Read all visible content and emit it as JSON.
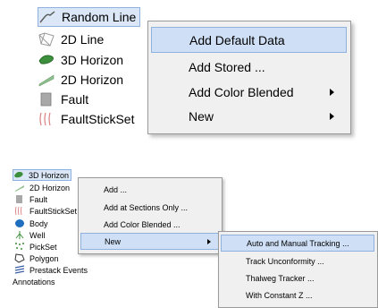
{
  "top": {
    "tree": [
      {
        "label": "Random Line",
        "icon": "random-line-icon"
      },
      {
        "label": "2D Line",
        "icon": "2d-line-icon"
      },
      {
        "label": "3D Horizon",
        "icon": "3d-horizon-icon"
      },
      {
        "label": "2D Horizon",
        "icon": "2d-horizon-icon"
      },
      {
        "label": "Fault",
        "icon": "fault-icon"
      },
      {
        "label": "FaultStickSet",
        "icon": "faultstickset-icon"
      }
    ],
    "menu": [
      {
        "label": "Add Default Data"
      },
      {
        "label": "Add Stored ..."
      },
      {
        "label": "Add Color Blended"
      },
      {
        "label": "New"
      }
    ]
  },
  "bottom": {
    "tree": [
      {
        "label": "3D Horizon",
        "icon": "3d-horizon-icon"
      },
      {
        "label": "2D Horizon",
        "icon": "2d-horizon-icon"
      },
      {
        "label": "Fault",
        "icon": "fault-icon"
      },
      {
        "label": "FaultStickSet",
        "icon": "faultstickset-icon"
      },
      {
        "label": "Body",
        "icon": "body-icon"
      },
      {
        "label": "Well",
        "icon": "well-icon"
      },
      {
        "label": "PickSet",
        "icon": "pickset-icon"
      },
      {
        "label": "Polygon",
        "icon": "polygon-icon"
      },
      {
        "label": "Prestack Events",
        "icon": "prestack-events-icon"
      },
      {
        "label": "Annotations",
        "icon": ""
      }
    ],
    "menu": [
      {
        "label": "Add ..."
      },
      {
        "label": "Add at Sections Only ..."
      },
      {
        "label": "Add Color Blended ..."
      },
      {
        "label": "New"
      }
    ],
    "submenu": [
      {
        "label": "Auto and Manual Tracking ..."
      },
      {
        "label": "Track Unconformity ..."
      },
      {
        "label": "Thalweg Tracker ..."
      },
      {
        "label": "With Constant Z ..."
      }
    ]
  },
  "colors": {
    "selection": "#dbe7f7",
    "menu_bg": "#f0f0f0",
    "horizon_green": "#3c8f3c",
    "fault_red": "#c44d4d"
  }
}
